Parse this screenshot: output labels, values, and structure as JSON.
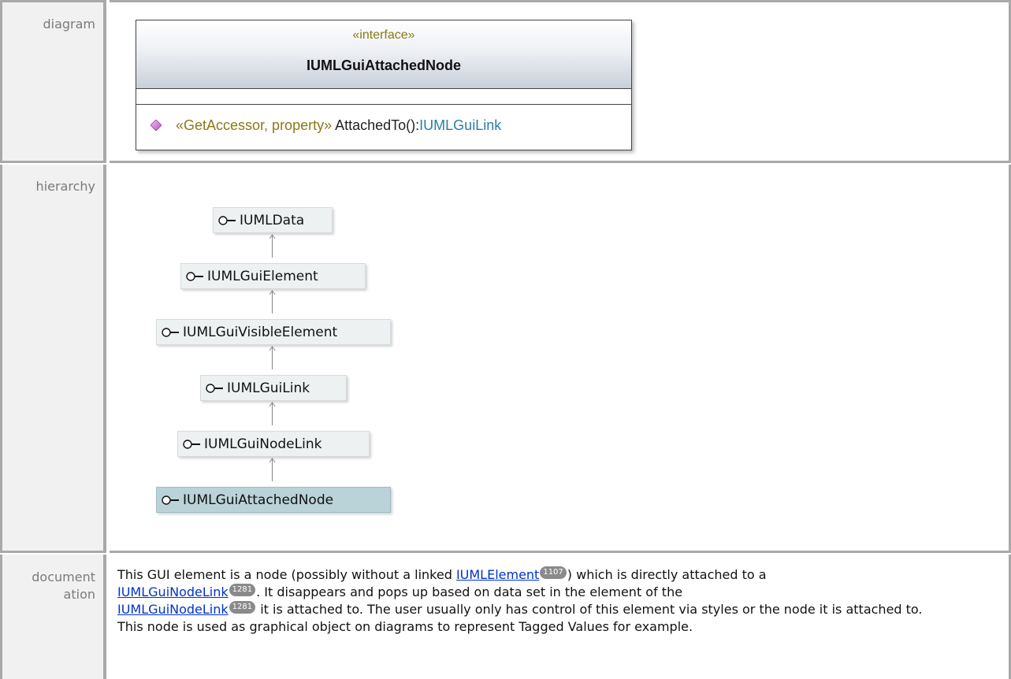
{
  "labels": {
    "diagram": "diagram",
    "hierarchy": "hierarchy",
    "documentation_1": "document",
    "documentation_2": "ation"
  },
  "uml": {
    "stereotype": "«interface»",
    "name": "IUMLGuiAttachedNode",
    "operation": {
      "stereotype": "«GetAccessor, property»",
      "name": " AttachedTo():",
      "return_type": "IUMLGuiLink",
      "icon": "diamond-icon"
    }
  },
  "hierarchy": {
    "nodes": [
      {
        "label": "IUMLData",
        "icon": "lollipop-interface-icon"
      },
      {
        "label": "IUMLGuiElement",
        "icon": "lollipop-interface-icon"
      },
      {
        "label": "IUMLGuiVisibleElement",
        "icon": "lollipop-interface-icon"
      },
      {
        "label": "IUMLGuiLink",
        "icon": "lollipop-interface-icon"
      },
      {
        "label": "IUMLGuiNodeLink",
        "icon": "lollipop-interface-icon"
      },
      {
        "label": "IUMLGuiAttachedNode",
        "icon": "lollipop-interface-icon",
        "selected": true
      }
    ]
  },
  "documentation": {
    "t1": "This GUI element is a node (possibly without a linked ",
    "link1": "IUMLElement",
    "badge1": "1107",
    "t2": ") which is directly attached to a",
    "link2": "IUMLGuiNodeLink",
    "badge2": "1281",
    "t3": ". It disappears and pops up based on data set in the element of the",
    "link3": "IUMLGuiNodeLink",
    "badge3": "1281",
    "t4": " it is attached to. The user usually only has control of this element via styles or the node it is attached to.",
    "t5": "This node is used as graphical object on diagrams to represent Tagged Values for example."
  },
  "colors": {
    "label_bg": "#f1f1f1",
    "border": "#a9a9a9",
    "stereotype": "#8a7a18",
    "type": "#2a7fa0",
    "link": "#0033cc",
    "selected_node": "#b9d3d9"
  }
}
